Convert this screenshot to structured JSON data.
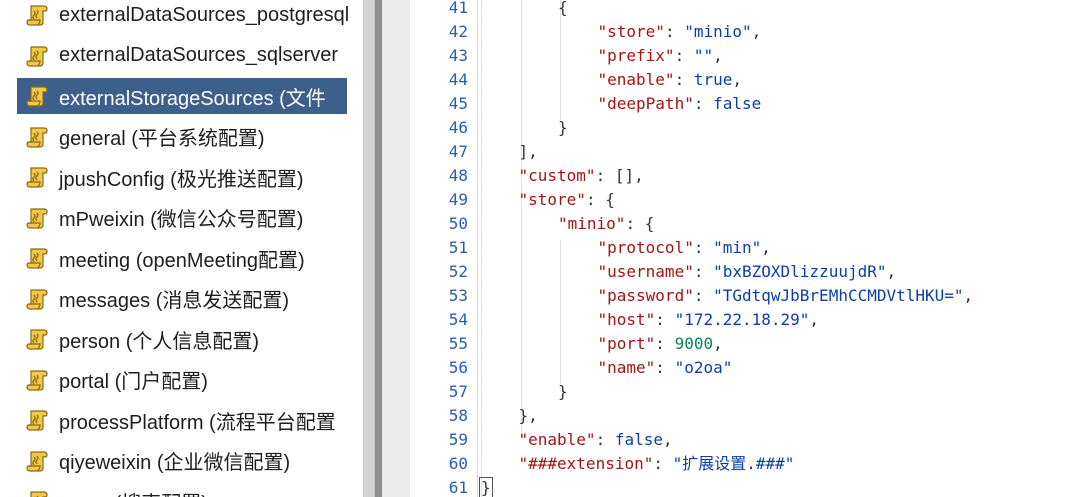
{
  "tree": {
    "items": [
      {
        "label": "externalDataSources_postgresql",
        "selected": false
      },
      {
        "label": "externalDataSources_sqlserver",
        "selected": false
      },
      {
        "label": "externalStorageSources (文件",
        "selected": true
      },
      {
        "label": "general (平台系统配置)",
        "selected": false
      },
      {
        "label": "jpushConfig (极光推送配置)",
        "selected": false
      },
      {
        "label": "mPweixin (微信公众号配置)",
        "selected": false
      },
      {
        "label": "meeting (openMeeting配置)",
        "selected": false
      },
      {
        "label": "messages (消息发送配置)",
        "selected": false
      },
      {
        "label": "person (个人信息配置)",
        "selected": false
      },
      {
        "label": "portal (门户配置)",
        "selected": false
      },
      {
        "label": "processPlatform (流程平台配置",
        "selected": false
      },
      {
        "label": "qiyeweixin (企业微信配置)",
        "selected": false
      },
      {
        "label": "query (搜索配置)",
        "selected": false
      }
    ],
    "item_icon": "script-scroll-icon"
  },
  "editor": {
    "lines": [
      {
        "n": "41",
        "indent": 2,
        "tokens": [
          [
            "p",
            "{"
          ]
        ]
      },
      {
        "n": "42",
        "indent": 3,
        "tokens": [
          [
            "k",
            "\"store\""
          ],
          [
            "p",
            ": "
          ],
          [
            "s",
            "\"minio\""
          ],
          [
            "p",
            ","
          ]
        ]
      },
      {
        "n": "43",
        "indent": 3,
        "tokens": [
          [
            "k",
            "\"prefix\""
          ],
          [
            "p",
            ": "
          ],
          [
            "s",
            "\"\""
          ],
          [
            "p",
            ","
          ]
        ]
      },
      {
        "n": "44",
        "indent": 3,
        "tokens": [
          [
            "k",
            "\"enable\""
          ],
          [
            "p",
            ": "
          ],
          [
            "b",
            "true"
          ],
          [
            "p",
            ","
          ]
        ]
      },
      {
        "n": "45",
        "indent": 3,
        "tokens": [
          [
            "k",
            "\"deepPath\""
          ],
          [
            "p",
            ": "
          ],
          [
            "b",
            "false"
          ]
        ]
      },
      {
        "n": "46",
        "indent": 2,
        "tokens": [
          [
            "p",
            "}"
          ]
        ]
      },
      {
        "n": "47",
        "indent": 1,
        "tokens": [
          [
            "p",
            "],"
          ]
        ]
      },
      {
        "n": "48",
        "indent": 1,
        "tokens": [
          [
            "k",
            "\"custom\""
          ],
          [
            "p",
            ": [],"
          ]
        ]
      },
      {
        "n": "49",
        "indent": 1,
        "tokens": [
          [
            "k",
            "\"store\""
          ],
          [
            "p",
            ": {"
          ]
        ]
      },
      {
        "n": "50",
        "indent": 2,
        "tokens": [
          [
            "k",
            "\"minio\""
          ],
          [
            "p",
            ": {"
          ]
        ]
      },
      {
        "n": "51",
        "indent": 3,
        "tokens": [
          [
            "k",
            "\"protocol\""
          ],
          [
            "p",
            ": "
          ],
          [
            "s",
            "\"min\""
          ],
          [
            "p",
            ","
          ]
        ]
      },
      {
        "n": "52",
        "indent": 3,
        "tokens": [
          [
            "k",
            "\"username\""
          ],
          [
            "p",
            ": "
          ],
          [
            "s",
            "\"bxBZOXDlizzuujdR\""
          ],
          [
            "p",
            ","
          ]
        ]
      },
      {
        "n": "53",
        "indent": 3,
        "tokens": [
          [
            "k",
            "\"password\""
          ],
          [
            "p",
            ": "
          ],
          [
            "s",
            "\"TGdtqwJbBrEMhCCMDVtlHKU=\""
          ],
          [
            "p",
            ","
          ]
        ]
      },
      {
        "n": "54",
        "indent": 3,
        "tokens": [
          [
            "k",
            "\"host\""
          ],
          [
            "p",
            ": "
          ],
          [
            "s",
            "\"172.22.18.29\""
          ],
          [
            "p",
            ","
          ]
        ]
      },
      {
        "n": "55",
        "indent": 3,
        "tokens": [
          [
            "k",
            "\"port\""
          ],
          [
            "p",
            ": "
          ],
          [
            "n",
            "9000"
          ],
          [
            "p",
            ","
          ]
        ]
      },
      {
        "n": "56",
        "indent": 3,
        "tokens": [
          [
            "k",
            "\"name\""
          ],
          [
            "p",
            ": "
          ],
          [
            "s",
            "\"o2oa\""
          ]
        ]
      },
      {
        "n": "57",
        "indent": 2,
        "tokens": [
          [
            "p",
            "}"
          ]
        ]
      },
      {
        "n": "58",
        "indent": 1,
        "tokens": [
          [
            "p",
            "},"
          ]
        ]
      },
      {
        "n": "59",
        "indent": 1,
        "tokens": [
          [
            "k",
            "\"enable\""
          ],
          [
            "p",
            ": "
          ],
          [
            "b",
            "false"
          ],
          [
            "p",
            ","
          ]
        ]
      },
      {
        "n": "60",
        "indent": 1,
        "tokens": [
          [
            "k",
            "\"###extension\""
          ],
          [
            "p",
            ": "
          ],
          [
            "s",
            "\"扩展设置.###\""
          ]
        ]
      },
      {
        "n": "61",
        "indent": 0,
        "tokens": [
          [
            "p",
            "}"
          ]
        ]
      }
    ]
  }
}
